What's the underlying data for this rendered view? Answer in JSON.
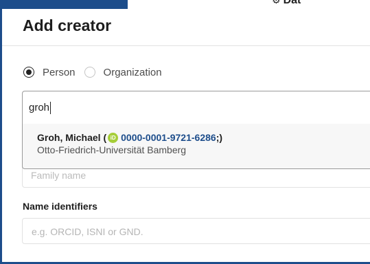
{
  "background": {
    "header_icon": "gear-icon",
    "header_text": "Dat"
  },
  "modal": {
    "title": "Add creator",
    "creator_type": {
      "options": [
        {
          "label": "Person",
          "checked": true
        },
        {
          "label": "Organization",
          "checked": false
        }
      ]
    },
    "search": {
      "value": "groh"
    },
    "suggestion": {
      "name_prefix": "Groh, Michael (",
      "orcid_icon": "orcid-icon",
      "orcid_icon_text": "iD",
      "orcid_id": "0000-0001-9721-6286",
      "name_suffix": ";)",
      "affiliation": "Otto-Friedrich-Universität Bamberg"
    },
    "family_name": {
      "placeholder": "Family name"
    },
    "name_identifiers": {
      "label": "Name identifiers",
      "placeholder": "e.g. ORCID, ISNI or GND."
    }
  },
  "colors": {
    "frame": "#1d4d8b",
    "orcid_green": "#a6ce39",
    "link_blue": "#1d4d8b"
  }
}
